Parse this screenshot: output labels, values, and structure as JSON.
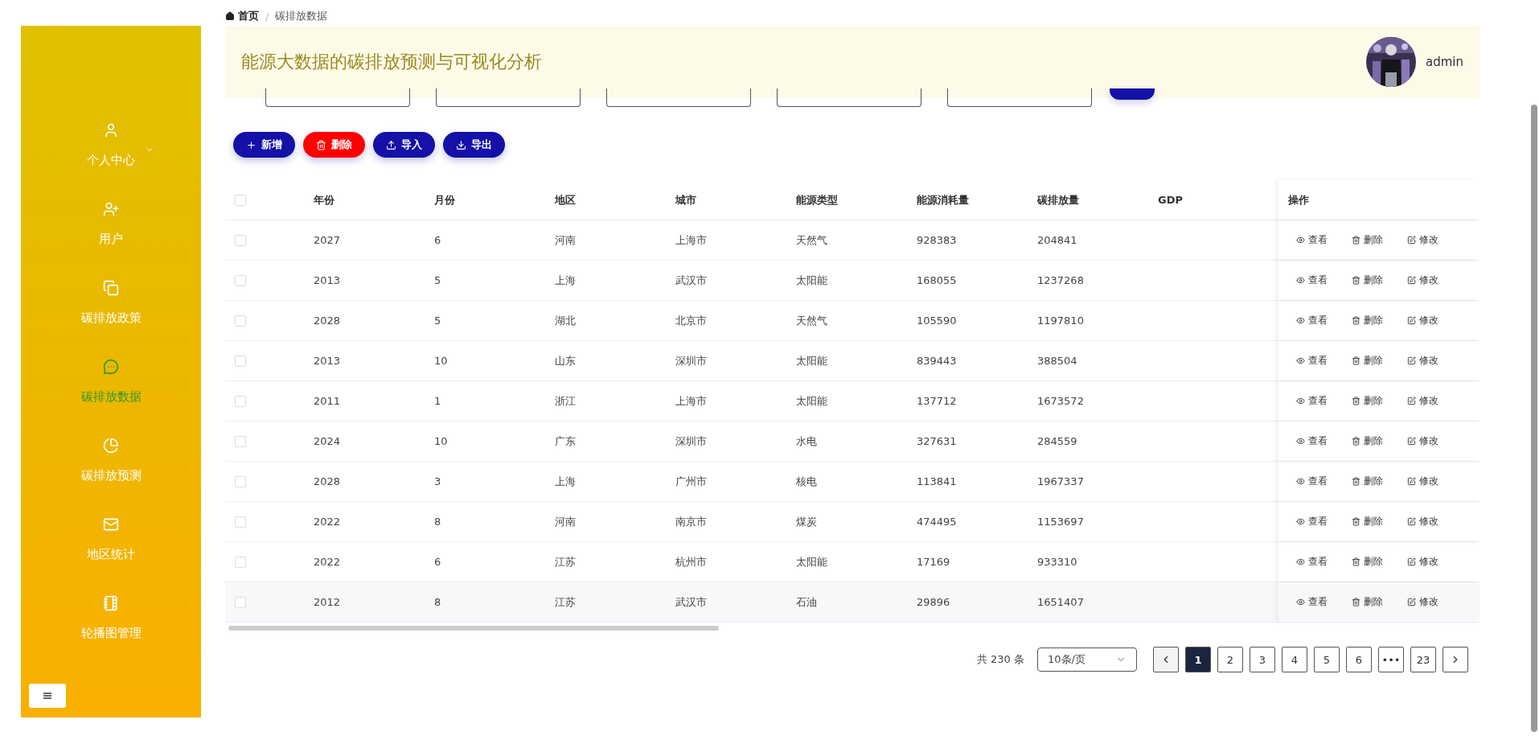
{
  "breadcrumb": {
    "separator": "/",
    "items": [
      {
        "label": "首页",
        "kind": "home"
      },
      {
        "label": "碳排放数据",
        "kind": "page"
      }
    ]
  },
  "header": {
    "title": "能源大数据的碳排放预测与可视化分析",
    "user": "admin"
  },
  "sidebar": {
    "items": [
      {
        "label": "个人中心",
        "kind": "user",
        "expandable": true,
        "selected": false
      },
      {
        "label": "用户",
        "kind": "user-add",
        "expandable": false,
        "selected": false
      },
      {
        "label": "碳排放政策",
        "kind": "copy",
        "expandable": false,
        "selected": false
      },
      {
        "label": "碳排放数据",
        "kind": "chat",
        "expandable": false,
        "selected": true
      },
      {
        "label": "碳排放预测",
        "kind": "pie",
        "expandable": false,
        "selected": false
      },
      {
        "label": "地区统计",
        "kind": "mail",
        "expandable": false,
        "selected": false
      },
      {
        "label": "轮播图管理",
        "kind": "notebook",
        "expandable": false,
        "selected": false
      }
    ]
  },
  "toolbar": [
    {
      "label": "新增",
      "kind": "add"
    },
    {
      "label": "删除",
      "kind": "delete"
    },
    {
      "label": "导入",
      "kind": "import"
    },
    {
      "label": "导出",
      "kind": "export"
    }
  ],
  "table": {
    "all_checked": false,
    "columns": [
      "年份",
      "月份",
      "地区",
      "城市",
      "能源类型",
      "能源消耗量",
      "碳排放量",
      "GDP",
      "操作"
    ],
    "rows": [
      {
        "checked": false,
        "cells": [
          "2027",
          "6",
          "河南",
          "上海市",
          "天然气",
          "928383",
          "204841"
        ],
        "actions": [
          {
            "label": "查看",
            "kind": "view"
          },
          {
            "label": "删除",
            "kind": "delete"
          },
          {
            "label": "修改",
            "kind": "edit"
          }
        ]
      },
      {
        "checked": false,
        "cells": [
          "2013",
          "5",
          "上海",
          "武汉市",
          "太阳能",
          "168055",
          "1237268"
        ],
        "actions": [
          {
            "label": "查看",
            "kind": "view"
          },
          {
            "label": "删除",
            "kind": "delete"
          },
          {
            "label": "修改",
            "kind": "edit"
          }
        ]
      },
      {
        "checked": false,
        "cells": [
          "2028",
          "5",
          "湖北",
          "北京市",
          "天然气",
          "105590",
          "1197810"
        ],
        "actions": [
          {
            "label": "查看",
            "kind": "view"
          },
          {
            "label": "删除",
            "kind": "delete"
          },
          {
            "label": "修改",
            "kind": "edit"
          }
        ]
      },
      {
        "checked": false,
        "cells": [
          "2013",
          "10",
          "山东",
          "深圳市",
          "太阳能",
          "839443",
          "388504"
        ],
        "actions": [
          {
            "label": "查看",
            "kind": "view"
          },
          {
            "label": "删除",
            "kind": "delete"
          },
          {
            "label": "修改",
            "kind": "edit"
          }
        ]
      },
      {
        "checked": false,
        "cells": [
          "2011",
          "1",
          "浙江",
          "上海市",
          "太阳能",
          "137712",
          "1673572"
        ],
        "actions": [
          {
            "label": "查看",
            "kind": "view"
          },
          {
            "label": "删除",
            "kind": "delete"
          },
          {
            "label": "修改",
            "kind": "edit"
          }
        ]
      },
      {
        "checked": false,
        "cells": [
          "2024",
          "10",
          "广东",
          "深圳市",
          "水电",
          "327631",
          "284559"
        ],
        "actions": [
          {
            "label": "查看",
            "kind": "view"
          },
          {
            "label": "删除",
            "kind": "delete"
          },
          {
            "label": "修改",
            "kind": "edit"
          }
        ]
      },
      {
        "checked": false,
        "cells": [
          "2028",
          "3",
          "上海",
          "广州市",
          "核电",
          "113841",
          "1967337"
        ],
        "actions": [
          {
            "label": "查看",
            "kind": "view"
          },
          {
            "label": "删除",
            "kind": "delete"
          },
          {
            "label": "修改",
            "kind": "edit"
          }
        ]
      },
      {
        "checked": false,
        "cells": [
          "2022",
          "8",
          "河南",
          "南京市",
          "煤炭",
          "474495",
          "1153697"
        ],
        "actions": [
          {
            "label": "查看",
            "kind": "view"
          },
          {
            "label": "删除",
            "kind": "delete"
          },
          {
            "label": "修改",
            "kind": "edit"
          }
        ]
      },
      {
        "checked": false,
        "cells": [
          "2022",
          "6",
          "江苏",
          "杭州市",
          "太阳能",
          "17169",
          "933310"
        ],
        "actions": [
          {
            "label": "查看",
            "kind": "view"
          },
          {
            "label": "删除",
            "kind": "delete"
          },
          {
            "label": "修改",
            "kind": "edit"
          }
        ]
      },
      {
        "checked": false,
        "cells": [
          "2012",
          "8",
          "江苏",
          "武汉市",
          "石油",
          "29896",
          "1651407"
        ],
        "actions": [
          {
            "label": "查看",
            "kind": "view"
          },
          {
            "label": "删除",
            "kind": "delete"
          },
          {
            "label": "修改",
            "kind": "edit"
          }
        ]
      }
    ]
  },
  "pagination": {
    "total": "共 230 条",
    "page_size": "10条/页",
    "pages": [
      {
        "label": "1",
        "selected": true
      },
      {
        "label": "2",
        "selected": false
      },
      {
        "label": "3",
        "selected": false
      },
      {
        "label": "4",
        "selected": false
      },
      {
        "label": "5",
        "selected": false
      },
      {
        "label": "6",
        "selected": false
      },
      {
        "label": "•••",
        "selected": false
      },
      {
        "label": "23",
        "selected": false
      }
    ]
  }
}
